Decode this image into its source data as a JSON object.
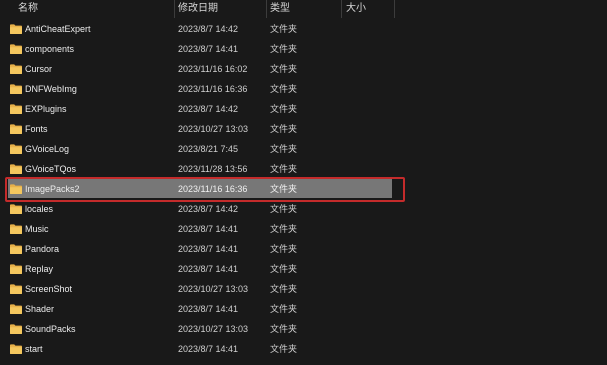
{
  "columns": {
    "name": "名称",
    "date": "修改日期",
    "type": "类型",
    "size": "大小"
  },
  "colors": {
    "folder": "#e8b14a",
    "selection": "#777777",
    "highlight": "#c42b2b"
  },
  "selected_index": 8,
  "rows": [
    {
      "name": "AntiCheatExpert",
      "date": "2023/8/7 14:42",
      "type": "文件夹",
      "icon": "folder-icon"
    },
    {
      "name": "components",
      "date": "2023/8/7 14:41",
      "type": "文件夹",
      "icon": "folder-icon"
    },
    {
      "name": "Cursor",
      "date": "2023/11/16 16:02",
      "type": "文件夹",
      "icon": "folder-icon"
    },
    {
      "name": "DNFWebImg",
      "date": "2023/11/16 16:36",
      "type": "文件夹",
      "icon": "folder-icon"
    },
    {
      "name": "EXPlugins",
      "date": "2023/8/7 14:42",
      "type": "文件夹",
      "icon": "folder-icon"
    },
    {
      "name": "Fonts",
      "date": "2023/10/27 13:03",
      "type": "文件夹",
      "icon": "folder-icon"
    },
    {
      "name": "GVoiceLog",
      "date": "2023/8/21 7:45",
      "type": "文件夹",
      "icon": "folder-icon"
    },
    {
      "name": "GVoiceTQos",
      "date": "2023/11/28 13:56",
      "type": "文件夹",
      "icon": "folder-icon"
    },
    {
      "name": "ImagePacks2",
      "date": "2023/11/16 16:36",
      "type": "文件夹",
      "icon": "folder-icon"
    },
    {
      "name": "locales",
      "date": "2023/8/7 14:42",
      "type": "文件夹",
      "icon": "folder-icon"
    },
    {
      "name": "Music",
      "date": "2023/8/7 14:41",
      "type": "文件夹",
      "icon": "folder-icon"
    },
    {
      "name": "Pandora",
      "date": "2023/8/7 14:41",
      "type": "文件夹",
      "icon": "folder-icon"
    },
    {
      "name": "Replay",
      "date": "2023/8/7 14:41",
      "type": "文件夹",
      "icon": "folder-icon"
    },
    {
      "name": "ScreenShot",
      "date": "2023/10/27 13:03",
      "type": "文件夹",
      "icon": "folder-icon"
    },
    {
      "name": "Shader",
      "date": "2023/8/7 14:41",
      "type": "文件夹",
      "icon": "folder-icon"
    },
    {
      "name": "SoundPacks",
      "date": "2023/10/27 13:03",
      "type": "文件夹",
      "icon": "folder-icon"
    },
    {
      "name": "start",
      "date": "2023/8/7 14:41",
      "type": "文件夹",
      "icon": "folder-icon"
    }
  ]
}
